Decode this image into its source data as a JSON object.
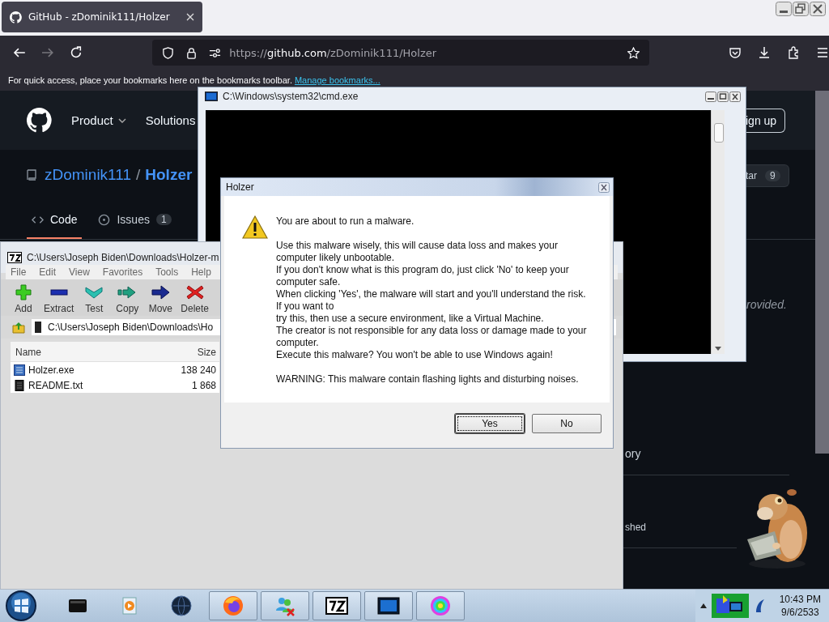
{
  "browser": {
    "tab": {
      "title": "GitHub - zDominik111/Holzer"
    },
    "url": {
      "prefix": "https://",
      "host": "github.com",
      "path": "/zDominik111/Holzer"
    },
    "bookmarks_bar": {
      "text": "For quick access, place your bookmarks here on the bookmarks toolbar.",
      "link": "Manage bookmarks..."
    }
  },
  "github": {
    "nav": [
      "Product",
      "Solutions"
    ],
    "signup": "ign up",
    "owner": "zDominik111",
    "separator": "/",
    "repo": "Holzer",
    "star": {
      "label": "tar",
      "count": "9"
    },
    "tabs": [
      {
        "label": "Code",
        "selected": true
      },
      {
        "label": "Issues",
        "count": "1",
        "selected": false
      }
    ],
    "side_texts": [
      "rovided.",
      "ory",
      "shed"
    ]
  },
  "cmd": {
    "title": "C:\\Windows\\system32\\cmd.exe"
  },
  "sevenzip": {
    "title": "C:\\Users\\Joseph Biden\\Downloads\\Holzer-m",
    "menu": [
      "File",
      "Edit",
      "View",
      "Favorites",
      "Tools",
      "Help"
    ],
    "tools": [
      {
        "label": "Add",
        "kind": "add"
      },
      {
        "label": "Extract",
        "kind": "extract"
      },
      {
        "label": "Test",
        "kind": "test"
      },
      {
        "label": "Copy",
        "kind": "copy"
      },
      {
        "label": "Move",
        "kind": "move"
      },
      {
        "label": "Delete",
        "kind": "delete"
      }
    ],
    "path": "C:\\Users\\Joseph Biden\\Downloads\\Ho",
    "columns": [
      "Name",
      "Size"
    ],
    "files": [
      {
        "name": "Holzer.exe",
        "size": "138 240",
        "kind": "exe"
      },
      {
        "name": "README.txt",
        "size": "1 868",
        "kind": "txt"
      }
    ]
  },
  "dialog": {
    "title": "Holzer",
    "blocks": [
      [
        "You are about to run a malware."
      ],
      [
        "Use this malware wisely, this will cause data loss and makes your computer likely unbootable.",
        "If you don't know what is this program do, just click 'No' to keep your computer safe.",
        "When clicking 'Yes', the malware will start and you'll understand the risk. If you want to",
        "try this, then use a secure environment, like a Virtual Machine.",
        "The creator is not responsible for any data loss or damage made to your computer.",
        "Execute this malware? You won't be able to use Windows again!"
      ],
      [
        "WARNING: This malware contain flashing lights and disturbing noises."
      ]
    ],
    "buttons": [
      {
        "label": "Yes",
        "focused": true
      },
      {
        "label": "No",
        "focused": false
      }
    ]
  },
  "taskbar": {
    "items": [
      {
        "kind": "folder",
        "running": false
      },
      {
        "kind": "media",
        "running": false
      },
      {
        "kind": "globe",
        "running": false
      },
      {
        "kind": "firefox",
        "running": true
      },
      {
        "kind": "messenger",
        "running": true
      },
      {
        "kind": "sevenzip",
        "running": true
      },
      {
        "kind": "cmd",
        "running": true
      },
      {
        "kind": "wheel",
        "running": true
      }
    ],
    "time": "10:43 PM",
    "date": "9/6/2533"
  }
}
